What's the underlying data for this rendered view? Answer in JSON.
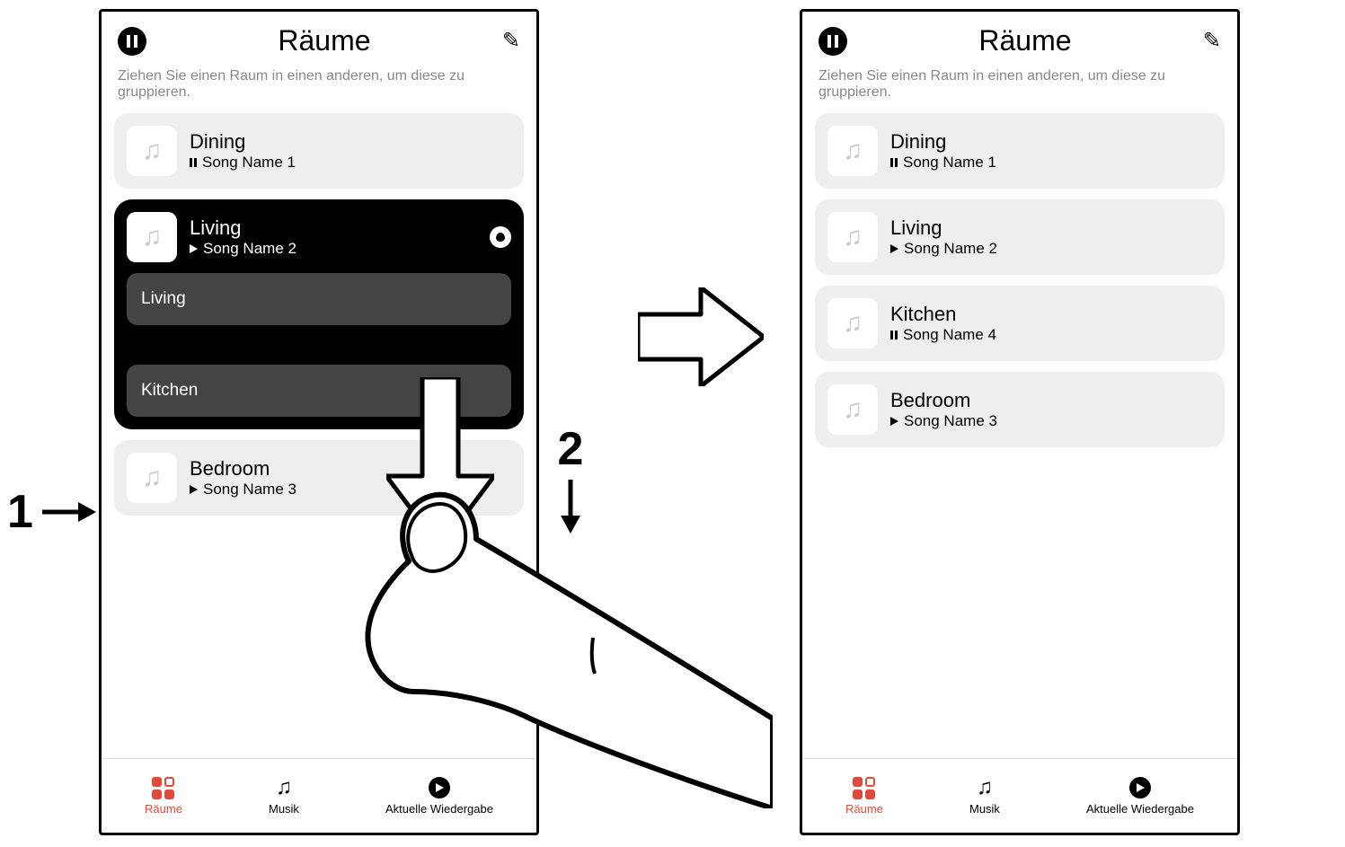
{
  "header": {
    "title": "Räume",
    "hint": "Ziehen Sie einen Raum in einen anderen, um diese zu gruppieren."
  },
  "left": {
    "cards": [
      {
        "room": "Dining",
        "song": "Song Name 1",
        "state": "pause"
      },
      {
        "room": "Living",
        "song": "Song Name 2",
        "state": "play",
        "group": [
          "Living",
          "Kitchen"
        ],
        "selected": true
      },
      {
        "room": "Bedroom",
        "song": "Song Name 3",
        "state": "play"
      }
    ]
  },
  "right": {
    "cards": [
      {
        "room": "Dining",
        "song": "Song Name 1",
        "state": "pause"
      },
      {
        "room": "Living",
        "song": "Song Name 2",
        "state": "play"
      },
      {
        "room": "Kitchen",
        "song": "Song Name 4",
        "state": "pause"
      },
      {
        "room": "Bedroom",
        "song": "Song Name 3",
        "state": "play"
      }
    ]
  },
  "tabs": {
    "rooms": "Räume",
    "music": "Musik",
    "now": "Aktuelle Wiedergabe"
  },
  "anno": {
    "one": "1",
    "two": "2"
  }
}
